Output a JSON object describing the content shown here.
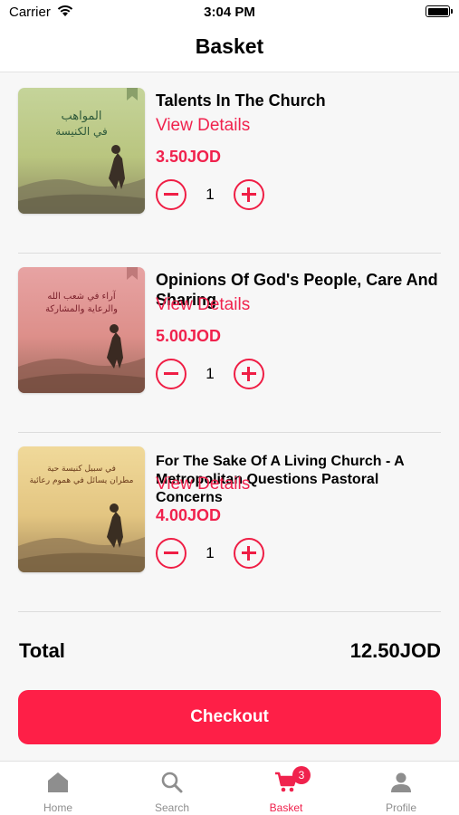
{
  "status_bar": {
    "carrier": "Carrier",
    "time": "3:04 PM"
  },
  "header": {
    "title": "Basket"
  },
  "items": [
    {
      "title": "Talents In The Church",
      "details_label": "View Details",
      "price": "3.50JOD",
      "quantity": "1",
      "cover_text": [
        "المواهب",
        "في الكنيسة"
      ]
    },
    {
      "title": "Opinions Of God's People, Care And Sharing",
      "details_label": "View Details",
      "price": "5.00JOD",
      "quantity": "1",
      "cover_text": [
        "آراء في شعب الله",
        "والرعاية والمشاركة"
      ]
    },
    {
      "title": "For The Sake Of A Living Church - A Metropolitan Questions Pastoral Concerns",
      "details_label": "View Details",
      "price": "4.00JOD",
      "quantity": "1",
      "cover_text": [
        "في سبيل كنيسة حية",
        "مطران يسائل في هموم رعائية"
      ]
    }
  ],
  "total": {
    "label": "Total",
    "value": "12.50JOD"
  },
  "checkout": {
    "label": "Checkout"
  },
  "tabs": [
    {
      "label": "Home",
      "icon": "home-icon"
    },
    {
      "label": "Search",
      "icon": "search-icon"
    },
    {
      "label": "Basket",
      "icon": "cart-icon",
      "badge": "3",
      "active": true
    },
    {
      "label": "Profile",
      "icon": "profile-icon"
    }
  ],
  "colors": {
    "accent": "#f0224d",
    "checkout": "#fe1f47",
    "tab_inactive": "#8e8e8e"
  }
}
